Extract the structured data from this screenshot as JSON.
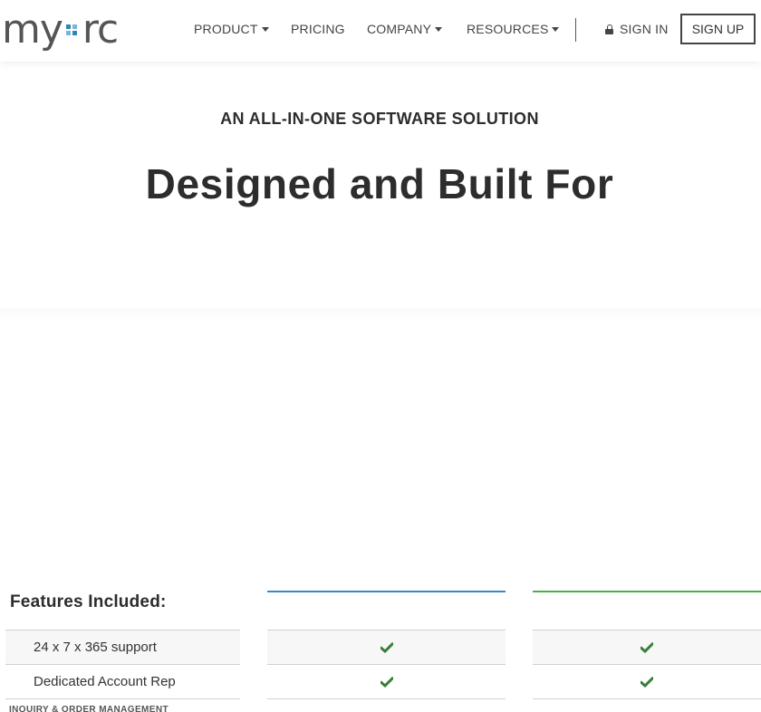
{
  "header": {
    "logo": {
      "left": "my",
      "right": "rc"
    },
    "nav": [
      {
        "label": "PRODUCT",
        "dropdown": true
      },
      {
        "label": "PRICING",
        "dropdown": false
      },
      {
        "label": "COMPANY",
        "dropdown": true
      },
      {
        "label": "RESOURCES",
        "dropdown": true
      }
    ],
    "sign_in": "SIGN IN",
    "sign_up": "SIGN UP"
  },
  "hero": {
    "eyebrow": "AN ALL-IN-ONE SOFTWARE SOLUTION",
    "title": "Designed and Built For"
  },
  "features": {
    "heading": "Features Included:",
    "rows": [
      {
        "label": "24 x 7 x 365 support",
        "plan_a": true,
        "plan_b": true
      },
      {
        "label": "Dedicated Account Rep",
        "plan_a": true,
        "plan_b": true
      }
    ],
    "section_label": "INQUIRY & ORDER MANAGEMENT"
  },
  "colors": {
    "plan_a_accent": "#3a87c8",
    "plan_b_accent": "#4aae48",
    "check": "#3a7d3a",
    "logo_blue": "#2f86b5"
  }
}
